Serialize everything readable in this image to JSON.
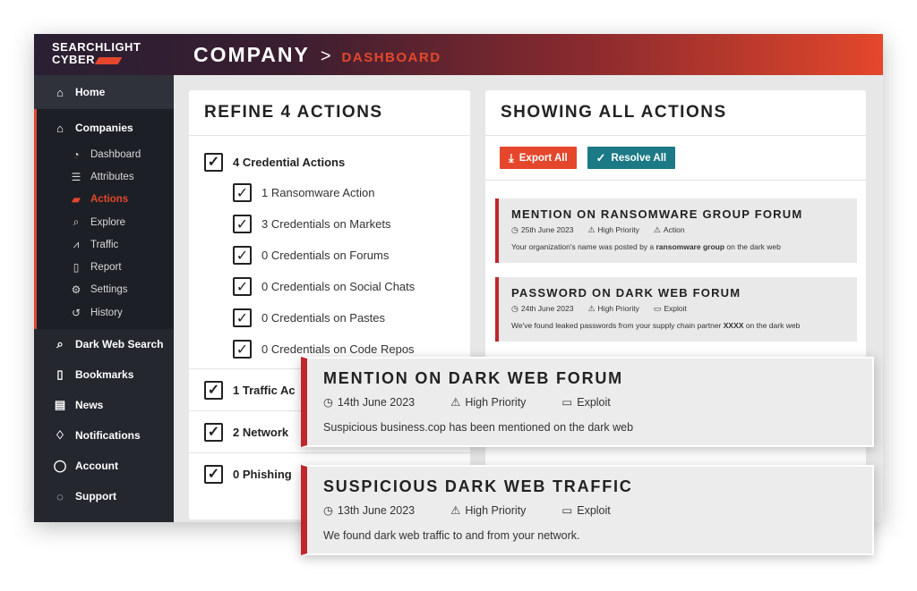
{
  "brand": {
    "line1": "SEARCHLIGHT",
    "line2": "CYBER"
  },
  "breadcrumb": {
    "main": "COMPANY",
    "separator": ">",
    "sub": "DASHBOARD"
  },
  "sidebar": {
    "home": "Home",
    "companies": "Companies",
    "company_items": [
      {
        "label": "Dashboard",
        "icon": "gauge-icon"
      },
      {
        "label": "Attributes",
        "icon": "list-icon"
      },
      {
        "label": "Actions",
        "icon": "actions-icon",
        "active": true
      },
      {
        "label": "Explore",
        "icon": "search-icon"
      },
      {
        "label": "Traffic",
        "icon": "traffic-icon"
      },
      {
        "label": "Report",
        "icon": "document-icon"
      },
      {
        "label": "Settings",
        "icon": "gear-icon"
      },
      {
        "label": "History",
        "icon": "history-icon"
      }
    ],
    "items": [
      {
        "label": "Dark Web Search",
        "icon": "search-icon"
      },
      {
        "label": "Bookmarks",
        "icon": "bookmark-icon"
      },
      {
        "label": "News",
        "icon": "news-icon"
      },
      {
        "label": "Notifications",
        "icon": "bell-icon"
      },
      {
        "label": "Account",
        "icon": "user-icon"
      },
      {
        "label": "Support",
        "icon": "chat-icon"
      }
    ]
  },
  "refine": {
    "title": "REFINE 4 ACTIONS",
    "group": "4 Credential Actions",
    "children": [
      "1 Ransomware Action",
      "3 Credentials on Markets",
      "0 Credentials on Forums",
      "0 Credentials on Social Chats",
      "0 Credentials on Pastes",
      "0 Credentials on Code Repos"
    ],
    "sections": [
      "1 Traffic Ac",
      "2 Network ",
      "0 Phishing "
    ]
  },
  "actions": {
    "title": "SHOWING ALL ACTIONS",
    "export_label": "Export All",
    "resolve_label": "Resolve All",
    "cards": [
      {
        "title": "MENTION ON RANSOMWARE GROUP FORUM",
        "date": "25th June 2023",
        "priority": "High Priority",
        "type": "Action",
        "desc_pre": "Your organization's name was posted by a ",
        "desc_bold": "ransomware group",
        "desc_post": " on the dark web"
      },
      {
        "title": "PASSWORD ON DARK WEB FORUM",
        "date": "24th June 2023",
        "priority": "High Priority",
        "type": "Exploit",
        "desc_pre": "We've found leaked passwords from your supply chain partner ",
        "desc_bold": "XXXX",
        "desc_post": " on the dark web"
      }
    ]
  },
  "floating": [
    {
      "title": "MENTION ON DARK WEB FORUM",
      "date": "14th June 2023",
      "priority": "High Priority",
      "type": "Exploit",
      "desc": "Suspicious business.cop has been mentioned on the dark web"
    },
    {
      "title": "SUSPICIOUS DARK WEB TRAFFIC",
      "date": "13th June 2023",
      "priority": "High Priority",
      "type": "Exploit",
      "desc": "We found dark web traffic to and from your network."
    }
  ],
  "colors": {
    "accent": "#e4472b",
    "alert_bar": "#c0262d",
    "resolve": "#1b7a85",
    "sidebar": "#25272f"
  }
}
